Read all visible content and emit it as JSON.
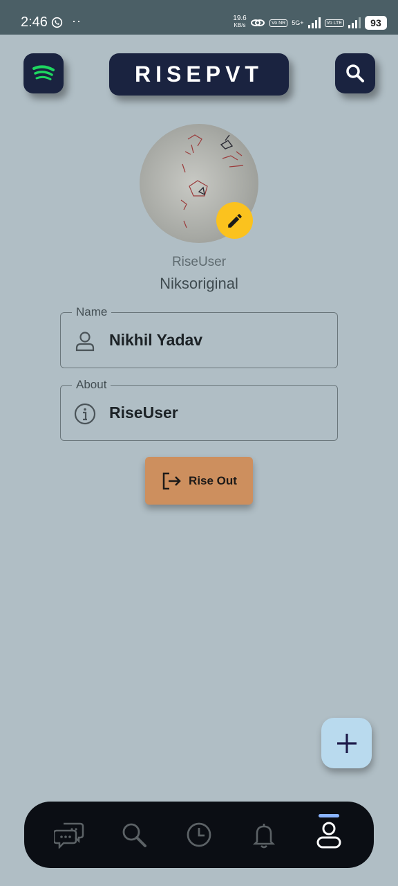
{
  "status_bar": {
    "time": "2:46",
    "dots": "··",
    "net_speed_value": "19.6",
    "net_speed_unit": "KB/s",
    "network_1": "5G+",
    "volte_1": "Vo NR",
    "volte_2": "Vo LTE",
    "battery": "93"
  },
  "header": {
    "title": "RISEPVT",
    "left_icon": "spotify-icon",
    "right_icon": "search-icon"
  },
  "profile": {
    "username": "RiseUser",
    "handle": "Niksoriginal",
    "edit_icon": "pencil-icon"
  },
  "fields": {
    "name": {
      "label": "Name",
      "value": "Nikhil Yadav",
      "icon": "person-icon"
    },
    "about": {
      "label": "About",
      "value": "RiseUser",
      "icon": "info-icon"
    }
  },
  "logout": {
    "label": "Rise Out",
    "icon": "logout-icon"
  },
  "fab": {
    "icon": "plus-icon"
  },
  "bottom_nav": {
    "items": [
      {
        "icon": "chat-icon"
      },
      {
        "icon": "search-icon"
      },
      {
        "icon": "clock-icon"
      },
      {
        "icon": "bell-icon"
      },
      {
        "icon": "profile-icon",
        "active": true
      }
    ]
  },
  "colors": {
    "background": "#b0bec5",
    "dark_button": "#1a2340",
    "accent_yellow": "#fbc21e",
    "logout_orange": "#cd8f5e",
    "fab_blue": "#b9daee",
    "nav_bg": "#0b0e14",
    "spotify_green": "#1ed760"
  }
}
